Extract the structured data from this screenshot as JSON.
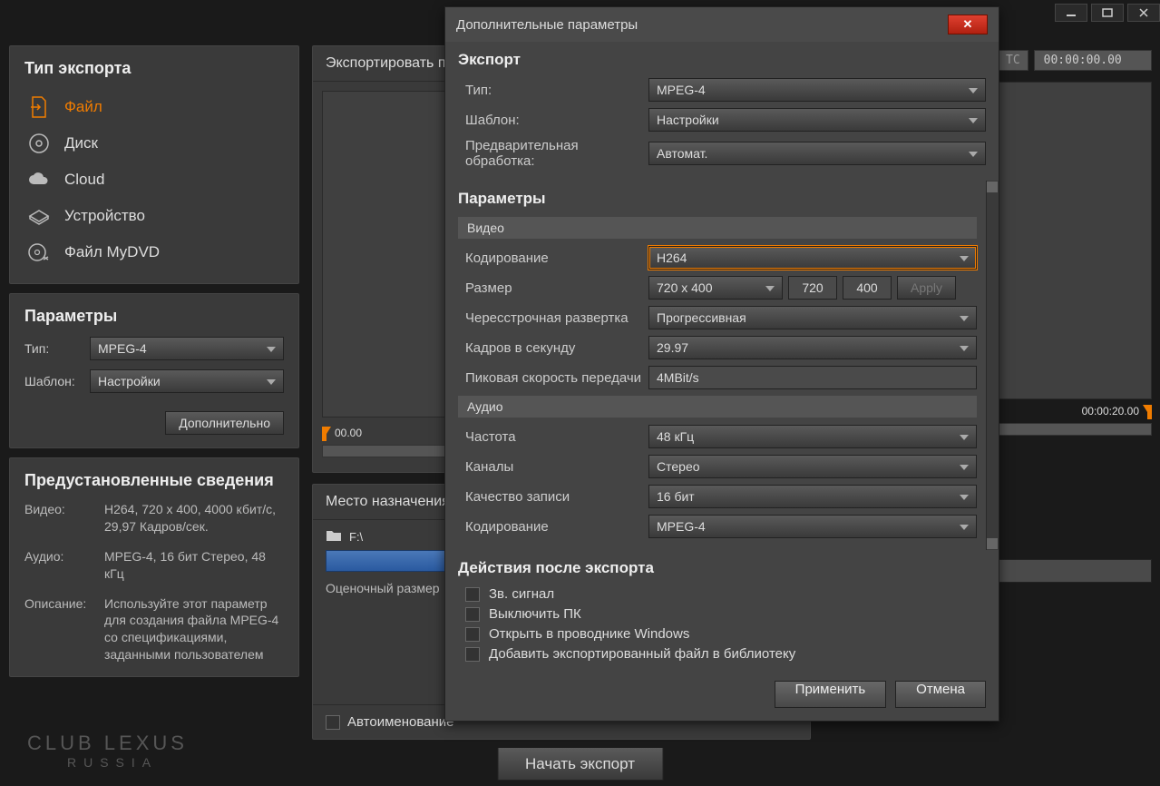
{
  "titlebar": {},
  "sidebar": {
    "export_type_title": "Тип экспорта",
    "items": [
      {
        "label": "Файл"
      },
      {
        "label": "Диск"
      },
      {
        "label": "Cloud"
      },
      {
        "label": "Устройство"
      },
      {
        "label": "Файл MyDVD"
      }
    ],
    "params_title": "Параметры",
    "type_label": "Тип:",
    "type_value": "MPEG-4",
    "template_label": "Шаблон:",
    "template_value": "Настройки",
    "more_btn": "Дополнительно",
    "preset_title": "Предустановленные сведения",
    "video_label": "Видео:",
    "video_value": "H264, 720 x 400, 4000 кбит/с, 29,97 Кадров/сек.",
    "audio_label": "Аудио:",
    "audio_value": "MPEG-4, 16 бит Стерео, 48 кГц",
    "desc_label": "Описание:",
    "desc_value": "Используйте этот параметр для создания файла MPEG-4 со спецификациями, заданными пользователем"
  },
  "middle": {
    "preview_title": "Экспортировать про",
    "tc_start": "00.00",
    "dest_title": "Место назначения",
    "folder": "F:\\",
    "size_label": "Оценочный размер",
    "auto_label": "Автоименование"
  },
  "right": {
    "tc_label": "TC",
    "tc_value": "00:00:00.00",
    "tc_end": "00:00:20.00"
  },
  "start_btn": "Начать экспорт",
  "dialog": {
    "title": "Дополнительные параметры",
    "export_sec": "Экспорт",
    "type_label": "Тип:",
    "type_value": "MPEG-4",
    "template_label": "Шаблон:",
    "template_value": "Настройки",
    "preproc_label": "Предварительная обработка:",
    "preproc_value": "Автомат.",
    "params_sec": "Параметры",
    "video_sub": "Видео",
    "enc_label": "Кодирование",
    "enc_value": "H264",
    "size_label": "Размер",
    "size_value": "720 x 400",
    "size_w": "720",
    "size_h": "400",
    "apply": "Apply",
    "interlace_label": "Чересстрочная развертка",
    "interlace_value": "Прогрессивная",
    "fps_label": "Кадров в секунду",
    "fps_value": "29.97",
    "peak_label": "Пиковая скорость передачи",
    "peak_value": "4MBit/s",
    "audio_sub": "Аудио",
    "freq_label": "Частота",
    "freq_value": "48 кГц",
    "chan_label": "Каналы",
    "chan_value": "Стерео",
    "qual_label": "Качество записи",
    "qual_value": "16 бит",
    "aenc_label": "Кодирование",
    "aenc_value": "MPEG-4",
    "actions_sec": "Действия после экспорта",
    "act1": "Зв. сигнал",
    "act2": "Выключить ПК",
    "act3": "Открыть в проводнике Windows",
    "act4": "Добавить экспортированный файл в библиотеку",
    "apply_btn": "Применить",
    "cancel_btn": "Отмена"
  },
  "watermark": {
    "line1": "CLUB LEXUS",
    "line2": "RUSSIA"
  }
}
